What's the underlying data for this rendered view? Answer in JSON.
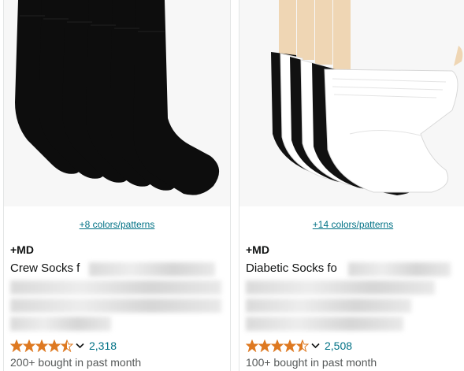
{
  "products": [
    {
      "colors_link": "+8 colors/patterns",
      "brand": "+MD",
      "title_lines": [
        "Crew Socks f",
        "",
        "",
        ""
      ],
      "rating_count": "2,318",
      "bought": "200+ bought in past month",
      "rating": 4.5
    },
    {
      "colors_link": "+14 colors/patterns",
      "brand": "+MD",
      "title_lines": [
        "Diabetic Socks fo",
        "",
        "",
        ""
      ],
      "rating_count": "2,508",
      "bought": "100+ bought in past month",
      "rating": 4.5
    }
  ],
  "colors": {
    "link": "#007185",
    "star": "#de7921",
    "muted": "#565959"
  },
  "icons": [
    "star-icon",
    "chevron-down-icon"
  ]
}
